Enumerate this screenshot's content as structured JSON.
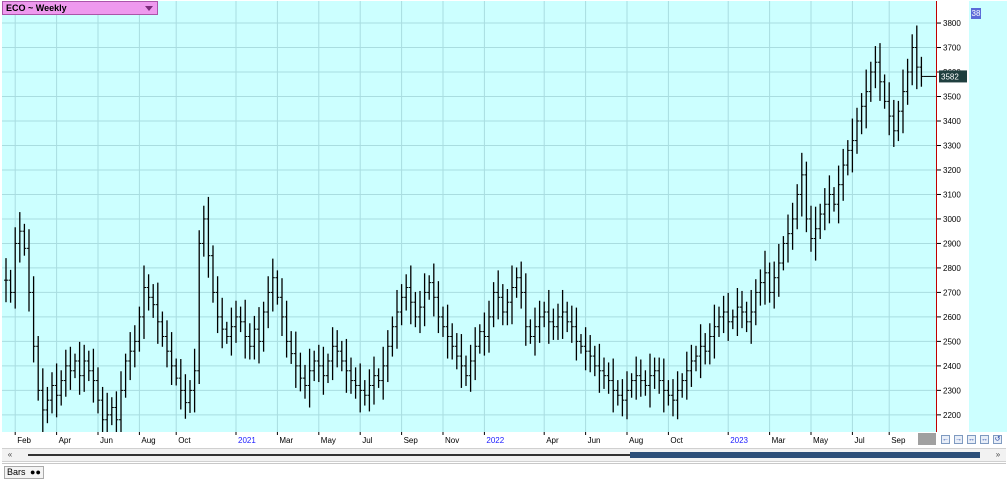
{
  "title": {
    "label": "ECO ~ Weekly",
    "panel_badge": "38"
  },
  "colors": {
    "background": "#ccffff",
    "bars": "#000000",
    "grid": "#a9dde0",
    "title_box": "#ee99ee",
    "last_price_box": "#1f3f3f",
    "scroll_thumb": "#2c4e78"
  },
  "bottom": {
    "tab_label": "Bars",
    "tab_icon": "chain-icon"
  },
  "navigation": {
    "scroll_left": "«",
    "scroll_right": "»"
  },
  "chart_data": {
    "type": "ohlc",
    "title": "ECO ~ Weekly",
    "last_price": "3582",
    "ylim": [
      2130,
      3890
    ],
    "y_ticks": [
      2200,
      2300,
      2400,
      2500,
      2600,
      2700,
      2800,
      2900,
      3000,
      3100,
      3200,
      3300,
      3400,
      3500,
      3600,
      3700,
      3800
    ],
    "x_ticks": [
      {
        "label": "Feb",
        "week": 2,
        "year": false
      },
      {
        "label": "Apr",
        "week": 11,
        "year": false
      },
      {
        "label": "Jun",
        "week": 20,
        "year": false
      },
      {
        "label": "Aug",
        "week": 29,
        "year": false
      },
      {
        "label": "Oct",
        "week": 37,
        "year": false
      },
      {
        "label": "2021",
        "week": 50,
        "year": true
      },
      {
        "label": "Mar",
        "week": 59,
        "year": false
      },
      {
        "label": "May",
        "week": 68,
        "year": false
      },
      {
        "label": "Jul",
        "week": 77,
        "year": false
      },
      {
        "label": "Sep",
        "week": 86,
        "year": false
      },
      {
        "label": "Nov",
        "week": 95,
        "year": false
      },
      {
        "label": "2022",
        "week": 104,
        "year": true
      },
      {
        "label": "Apr",
        "week": 117,
        "year": false
      },
      {
        "label": "Jun",
        "week": 126,
        "year": false
      },
      {
        "label": "Aug",
        "week": 135,
        "year": false
      },
      {
        "label": "Oct",
        "week": 144,
        "year": false
      },
      {
        "label": "2023",
        "week": 157,
        "year": true
      },
      {
        "label": "Mar",
        "week": 166,
        "year": false
      },
      {
        "label": "May",
        "week": 175,
        "year": false
      },
      {
        "label": "Jul",
        "week": 184,
        "year": false
      },
      {
        "label": "Sep",
        "week": 192,
        "year": false
      }
    ],
    "grid": true,
    "weekly_closes": [
      2750,
      2700,
      2900,
      2950,
      2880,
      2700,
      2480,
      2300,
      2220,
      2260,
      2320,
      2280,
      2340,
      2400,
      2380,
      2420,
      2360,
      2420,
      2380,
      2340,
      2260,
      2180,
      2200,
      2230,
      2180,
      2300,
      2420,
      2460,
      2500,
      2600,
      2720,
      2680,
      2650,
      2580,
      2520,
      2460,
      2400,
      2350,
      2300,
      2250,
      2300,
      2380,
      2900,
      3000,
      2850,
      2700,
      2600,
      2550,
      2520,
      2560,
      2600,
      2580,
      2520,
      2480,
      2550,
      2500,
      2620,
      2700,
      2760,
      2680,
      2600,
      2500,
      2450,
      2400,
      2350,
      2320,
      2380,
      2420,
      2400,
      2360,
      2420,
      2480,
      2460,
      2420,
      2380,
      2340,
      2320,
      2300,
      2280,
      2320,
      2360,
      2340,
      2400,
      2480,
      2560,
      2620,
      2680,
      2720,
      2660,
      2600,
      2640,
      2700,
      2740,
      2680,
      2600,
      2560,
      2520,
      2480,
      2440,
      2400,
      2360,
      2420,
      2480,
      2540,
      2520,
      2600,
      2700,
      2680,
      2620,
      2660,
      2720,
      2760,
      2700,
      2560,
      2520,
      2560,
      2600,
      2620,
      2580,
      2560,
      2600,
      2620,
      2580,
      2560,
      2500,
      2480,
      2460,
      2440,
      2400,
      2380,
      2360,
      2340,
      2300,
      2280,
      2260,
      2300,
      2340,
      2360,
      2340,
      2320,
      2360,
      2380,
      2340,
      2300,
      2280,
      2260,
      2300,
      2340,
      2380,
      2420,
      2440,
      2480,
      2460,
      2520,
      2560,
      2600,
      2620,
      2580,
      2600,
      2640,
      2620,
      2580,
      2620,
      2700,
      2740,
      2780,
      2700,
      2760,
      2820,
      2900,
      2940,
      3000,
      3100,
      3180,
      3000,
      2920,
      2960,
      3020,
      3060,
      3100,
      3060,
      3140,
      3220,
      3280,
      3320,
      3400,
      3460,
      3520,
      3600,
      3640,
      3560,
      3480,
      3420,
      3360,
      3440,
      3520,
      3600,
      3700,
      3620,
      3582
    ],
    "last_close": 3582
  }
}
